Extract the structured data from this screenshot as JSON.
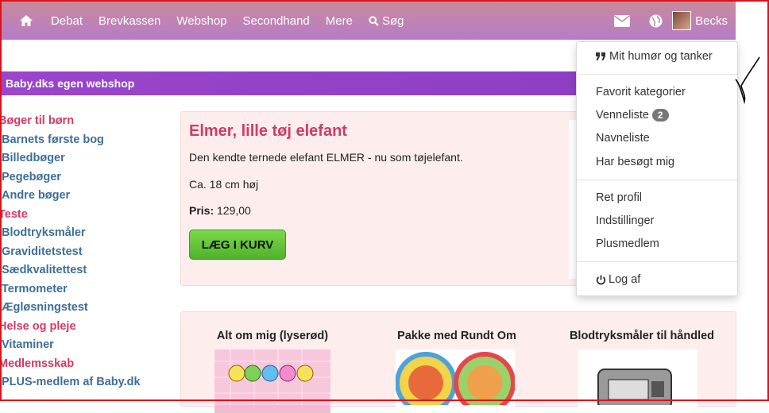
{
  "nav": {
    "items": [
      "Debat",
      "Brevkassen",
      "Webshop",
      "Secondhand",
      "Mere",
      "Søg"
    ],
    "user_name": "Becks",
    "home_icon": "home-icon",
    "search_icon": "search-icon",
    "mail_icon": "envelope-icon",
    "globe_icon": "globe-icon"
  },
  "banner": {
    "title": "Baby.dks egen webshop"
  },
  "sidebar": {
    "items": [
      {
        "label": "Bøger til børn",
        "style": "red"
      },
      {
        "label": "Barnets første bog",
        "style": "blue"
      },
      {
        "label": "Billedbøger",
        "style": "blue"
      },
      {
        "label": "Pegebøger",
        "style": "blue"
      },
      {
        "label": "Andre bøger",
        "style": "blue"
      },
      {
        "label": "Teste",
        "style": "red"
      },
      {
        "label": "Blodtryksmåler",
        "style": "blue"
      },
      {
        "label": "Graviditetstest",
        "style": "blue"
      },
      {
        "label": "Sædkvalitettest",
        "style": "blue"
      },
      {
        "label": "Termometer",
        "style": "blue"
      },
      {
        "label": "Ægløsningstest",
        "style": "blue"
      },
      {
        "label": "Helse og pleje",
        "style": "red"
      },
      {
        "label": "Vitaminer",
        "style": "blue"
      },
      {
        "label": "Medlemsskab",
        "style": "red"
      },
      {
        "label": "PLUS-medlem af Baby.dk",
        "style": "blue"
      }
    ]
  },
  "product": {
    "title": "Elmer, lille tøj elefant",
    "description": "Den kendte ternede elefant ELMER - nu som tøjelefant.",
    "size": "Ca. 18 cm høj",
    "price_label": "Pris:",
    "price_value": "129,00",
    "buy_label": "LÆG I KURV"
  },
  "related": {
    "items": [
      "Alt om mig (lyserød)",
      "Pakke med Rundt Om",
      "Blodtryksmåler til håndled"
    ]
  },
  "dropdown": {
    "mood": "Mit humør og tanker",
    "favorites": "Favorit kategorier",
    "friends": "Venneliste",
    "friends_count": "2",
    "names": "Navneliste",
    "visited": "Har besøgt mig",
    "edit_profile": "Ret profil",
    "settings": "Indstillinger",
    "plus": "Plusmedlem",
    "logout": "Log af"
  },
  "colors": {
    "nav_gradient_top": "#c98a9b",
    "nav_gradient_bottom": "#b77cc9",
    "banner": "#9a45cc",
    "link_blue": "#3d6e98",
    "link_red": "#d13a67",
    "buy_green": "#5cc133"
  }
}
